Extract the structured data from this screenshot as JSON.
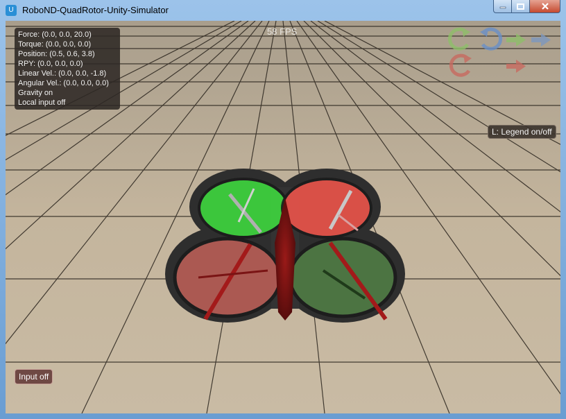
{
  "window": {
    "title": "RoboND-QuadRotor-Unity-Simulator"
  },
  "hud": {
    "fps": "58 FPS",
    "info_lines": [
      "Force: (0.0, 0.0, 20.0)",
      "Torque: (0.0, 0.0, 0.0)",
      "Position: (0.5, 0.6, 3.8)",
      "RPY: (0.0, 0.0, 0.0)",
      "Linear Vel.: (0.0, 0.0, -1.8)",
      "Angular Vel.: (0.0, 0.0, 0.0)",
      "Gravity on",
      "Local input off"
    ],
    "legend_button": "L: Legend on/off",
    "input_button": "Input off"
  },
  "legend_icons": [
    {
      "name": "rotate-ccw-icon",
      "color": "#8fbf6a"
    },
    {
      "name": "rotate-cw-icon",
      "color": "#6a90c8"
    },
    {
      "name": "arrow-right-icon",
      "color": "#8fbf6a"
    },
    {
      "name": "arrow-right-icon",
      "color": "#7d98bf"
    },
    {
      "name": "rotate-ccw-icon",
      "color": "#c86a60"
    },
    {
      "name": "arrow-right-icon",
      "color": "#c86a60"
    }
  ],
  "rotors": [
    {
      "position": "front-left",
      "color": "#3ed33e"
    },
    {
      "position": "front-right",
      "color": "#e8534a"
    },
    {
      "position": "rear-left",
      "color": "#b95e57"
    },
    {
      "position": "rear-right",
      "color": "#4f7a44"
    }
  ]
}
